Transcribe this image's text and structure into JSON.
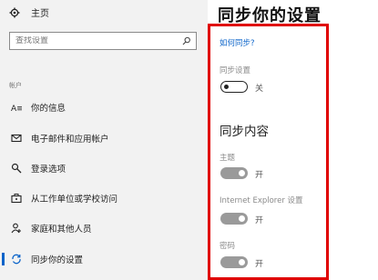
{
  "sidebar": {
    "home_label": "主页",
    "search_placeholder": "查找设置",
    "section_label": "帐户",
    "items": [
      {
        "label": "你的信息",
        "icon": "person-card-icon"
      },
      {
        "label": "电子邮件和应用帐户",
        "icon": "mail-icon"
      },
      {
        "label": "登录选项",
        "icon": "key-icon"
      },
      {
        "label": "从工作单位或学校访问",
        "icon": "briefcase-icon"
      },
      {
        "label": "家庭和其他人员",
        "icon": "people-icon"
      },
      {
        "label": "同步你的设置",
        "icon": "sync-icon",
        "active": true
      }
    ]
  },
  "main": {
    "title": "同步你的设置",
    "how_link": "如何同步?",
    "sync_settings": {
      "label": "同步设置",
      "state": "关",
      "on": false
    },
    "content_heading": "同步内容",
    "items": [
      {
        "label": "主题",
        "state": "开",
        "on": true
      },
      {
        "label": "Internet Explorer 设置",
        "state": "开",
        "on": true
      },
      {
        "label": "密码",
        "state": "开",
        "on": true
      }
    ]
  },
  "colors": {
    "accent": "#0a63c9",
    "highlight_box": "#e00000",
    "toggle_on": "#9a9a9a"
  }
}
